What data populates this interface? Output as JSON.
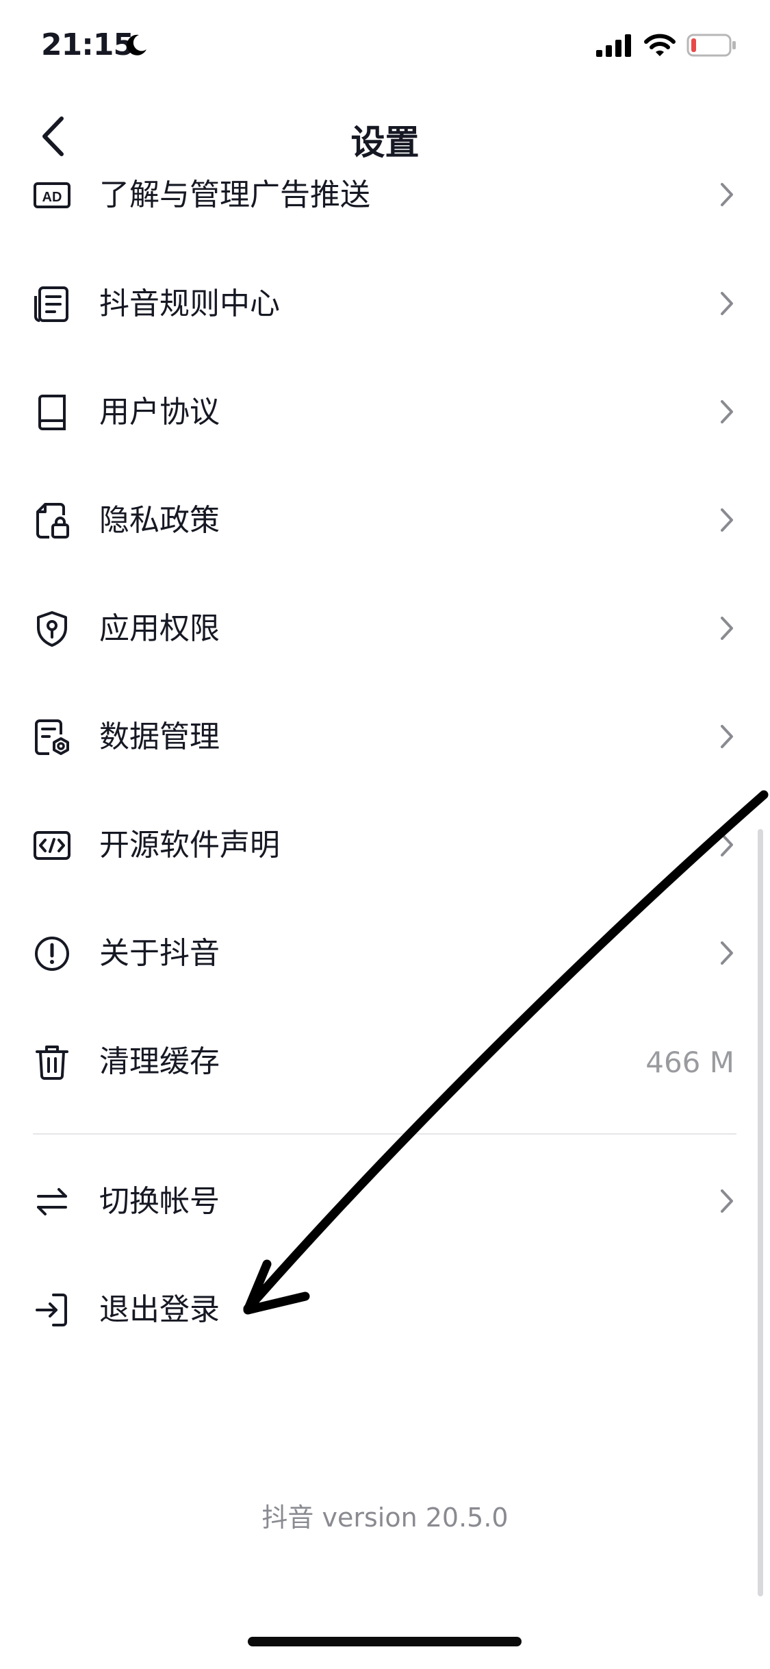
{
  "status_bar": {
    "time": "21:15",
    "moon_icon": "moon-icon",
    "signal_icon": "cellular-signal-icon",
    "wifi_icon": "wifi-icon",
    "battery_icon": "battery-low-icon",
    "battery_color": "#e84a4a"
  },
  "header": {
    "title": "设置",
    "back_icon": "chevron-left-icon"
  },
  "items": [
    {
      "label": "了解与管理广告推送",
      "icon": "ad-icon",
      "trailing": "chevron"
    },
    {
      "label": "抖音规则中心",
      "icon": "document-list-icon",
      "trailing": "chevron"
    },
    {
      "label": "用户协议",
      "icon": "book-icon",
      "trailing": "chevron"
    },
    {
      "label": "隐私政策",
      "icon": "document-lock-icon",
      "trailing": "chevron"
    },
    {
      "label": "应用权限",
      "icon": "shield-key-icon",
      "trailing": "chevron"
    },
    {
      "label": "数据管理",
      "icon": "document-gear-icon",
      "trailing": "chevron"
    },
    {
      "label": "开源软件声明",
      "icon": "code-icon",
      "trailing": "chevron"
    },
    {
      "label": "关于抖音",
      "icon": "info-circle-icon",
      "trailing": "chevron"
    },
    {
      "label": "清理缓存",
      "icon": "trash-icon",
      "trailing": "value",
      "value": "466 M"
    },
    {
      "label": "切换帐号",
      "icon": "swap-icon",
      "trailing": "chevron"
    },
    {
      "label": "退出登录",
      "icon": "logout-icon",
      "trailing": "none"
    }
  ],
  "footer": {
    "version": "抖音 version 20.5.0"
  },
  "colors": {
    "text_primary": "#161823",
    "text_secondary": "#9a9b9f",
    "chevron": "#8a8b91",
    "annotation_arrow": "#000000"
  }
}
